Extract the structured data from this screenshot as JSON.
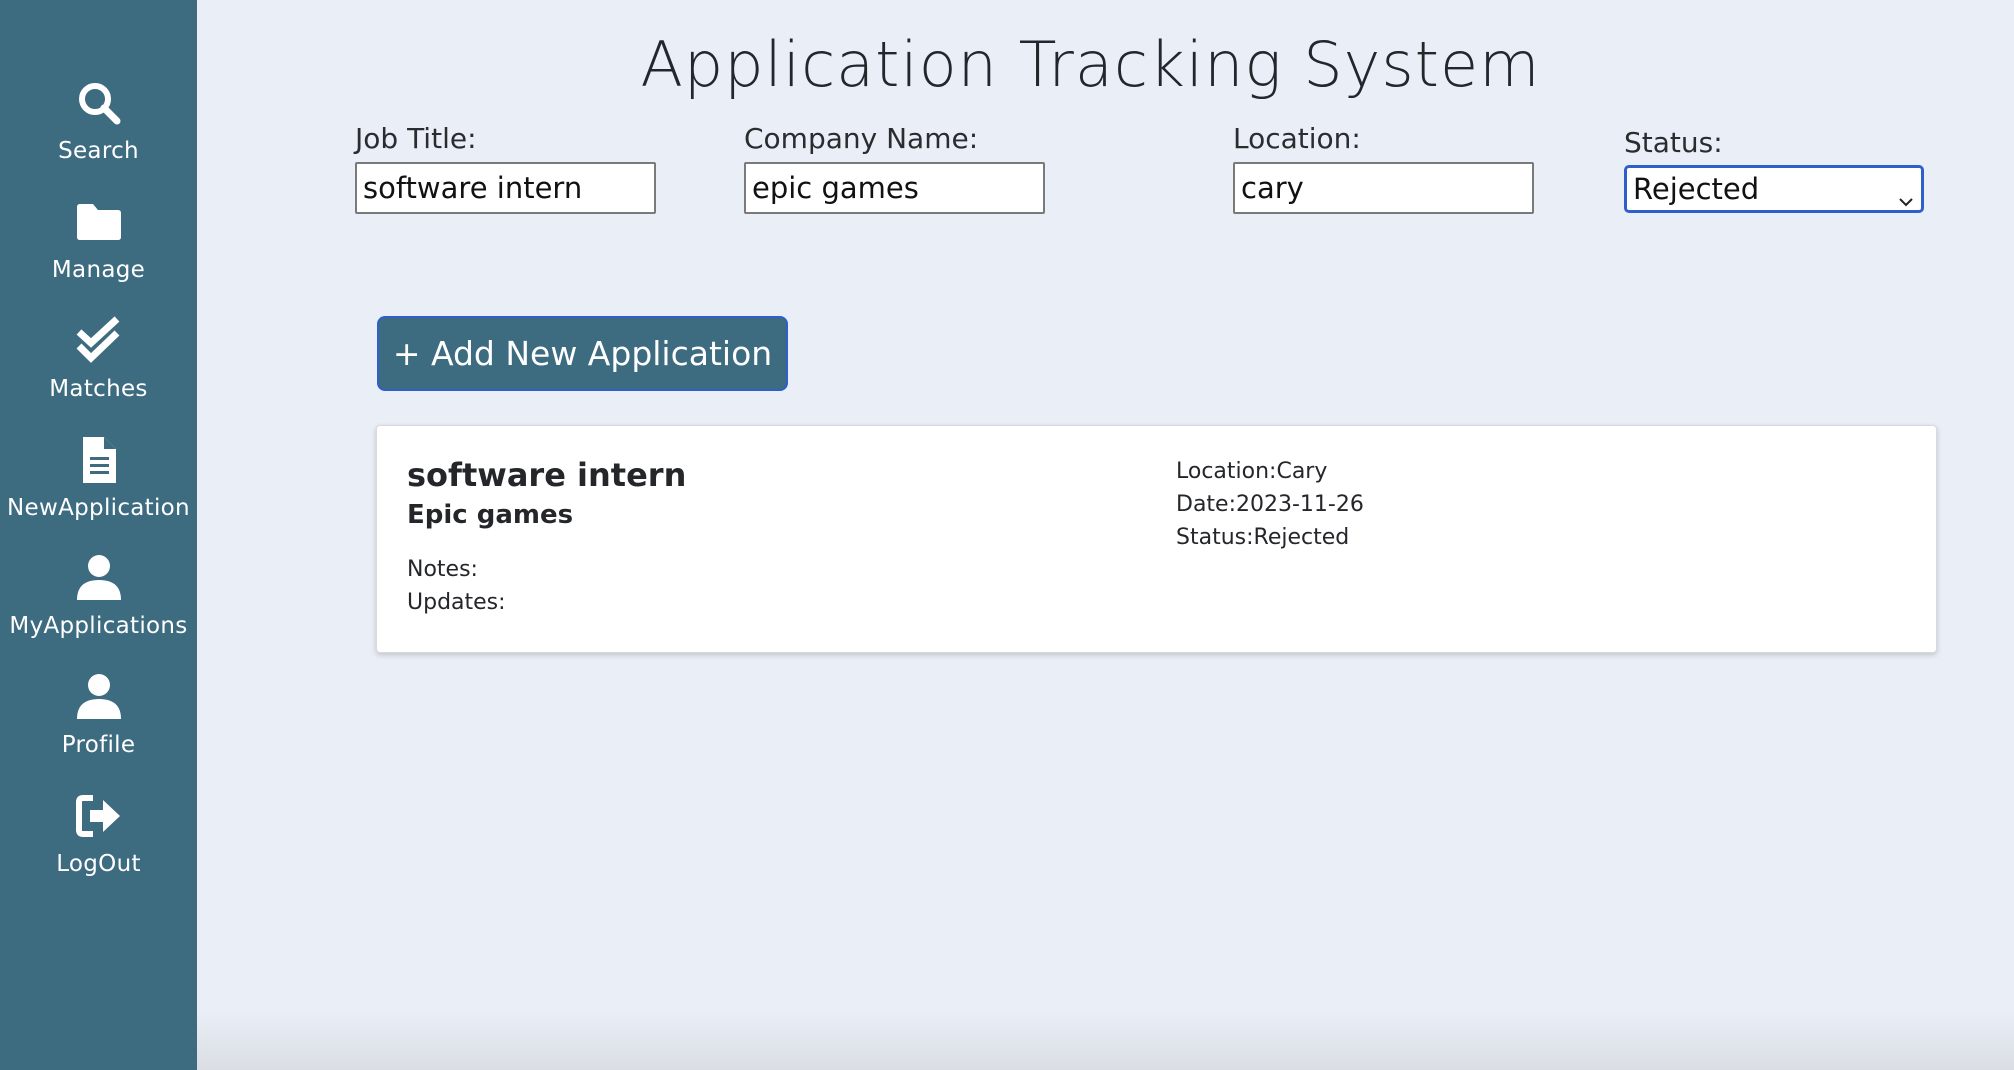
{
  "sidebar": {
    "items": [
      {
        "label": "Search",
        "icon": "search-icon"
      },
      {
        "label": "Manage",
        "icon": "folder-icon"
      },
      {
        "label": "Matches",
        "icon": "double-check-icon"
      },
      {
        "label": "NewApplication",
        "icon": "document-icon"
      },
      {
        "label": "MyApplications",
        "icon": "user-icon"
      },
      {
        "label": "Profile",
        "icon": "user-icon"
      },
      {
        "label": "LogOut",
        "icon": "logout-icon"
      }
    ]
  },
  "header": {
    "title": "Application Tracking System"
  },
  "filters": {
    "job_title": {
      "label": "Job Title:",
      "value": "software intern"
    },
    "company_name": {
      "label": "Company Name:",
      "value": "epic games"
    },
    "location": {
      "label": "Location:",
      "value": "cary"
    },
    "status": {
      "label": "Status:",
      "selected": "Rejected"
    }
  },
  "actions": {
    "add_label": "+ Add New Application"
  },
  "applications": [
    {
      "title": "software intern",
      "company": "Epic games",
      "notes": "Notes:",
      "updates": "Updates:",
      "location": "Location:Cary",
      "date": "Date:2023-11-26",
      "status": "Status:Rejected"
    }
  ],
  "colors": {
    "sidebar_bg": "#3d6b80",
    "page_bg": "#eaeef6",
    "focus_border": "#2f5fc9"
  }
}
